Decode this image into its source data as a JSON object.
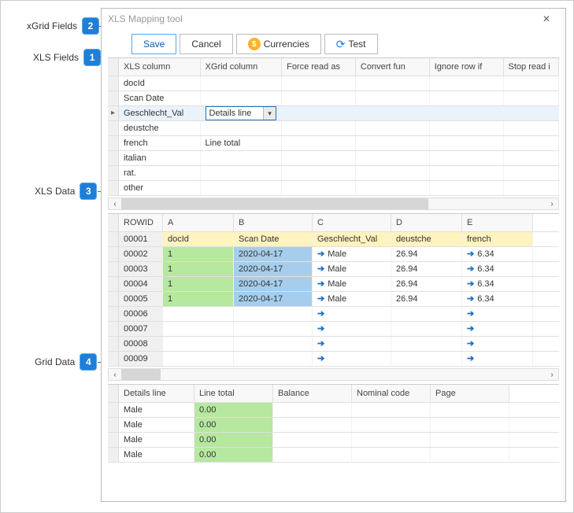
{
  "callouts": [
    {
      "num": "1",
      "label": "XLS Fields"
    },
    {
      "num": "2",
      "label": "xGrid Fields"
    },
    {
      "num": "3",
      "label": "XLS Data"
    },
    {
      "num": "4",
      "label": "Grid Data"
    }
  ],
  "window": {
    "title": "XLS Mapping tool",
    "close": "✕"
  },
  "toolbar": {
    "save": "Save",
    "cancel": "Cancel",
    "currencies": "Currencies",
    "test": "Test"
  },
  "mapGrid": {
    "headers": [
      "XLS column",
      "XGrid column",
      "Force read as",
      "Convert fun",
      "Ignore row if",
      "Stop read i"
    ],
    "rows": [
      {
        "xls": "docId",
        "xgrid": ""
      },
      {
        "xls": "Scan Date",
        "xgrid": ""
      },
      {
        "xls": "Geschlecht_Val",
        "xgrid": "Details line",
        "combo": true,
        "selected": true
      },
      {
        "xls": "deustche",
        "xgrid": ""
      },
      {
        "xls": "french",
        "xgrid": "Line total"
      },
      {
        "xls": "italian",
        "xgrid": ""
      },
      {
        "xls": "rat.",
        "xgrid": ""
      },
      {
        "xls": "other",
        "xgrid": ""
      }
    ]
  },
  "dataGrid": {
    "headers": [
      "ROWID",
      "A",
      "B",
      "C",
      "D",
      "E"
    ],
    "rows": [
      {
        "rowid": "00001",
        "A": "docId",
        "B": "Scan Date",
        "C": "Geschlecht_Val",
        "D": "deustche",
        "E": "french",
        "hdr": true
      },
      {
        "rowid": "00002",
        "A": "1",
        "B": "2020-04-17",
        "C": "Male",
        "D": "26.94",
        "E": "6.34",
        "arrowC": true,
        "arrowE": true,
        "greenA": true,
        "blueB": true
      },
      {
        "rowid": "00003",
        "A": "1",
        "B": "2020-04-17",
        "C": "Male",
        "D": "26.94",
        "E": "6.34",
        "arrowC": true,
        "arrowE": true,
        "greenA": true,
        "blueB": true
      },
      {
        "rowid": "00004",
        "A": "1",
        "B": "2020-04-17",
        "C": "Male",
        "D": "26.94",
        "E": "6.34",
        "arrowC": true,
        "arrowE": true,
        "greenA": true,
        "blueB": true
      },
      {
        "rowid": "00005",
        "A": "1",
        "B": "2020-04-17",
        "C": "Male",
        "D": "26.94",
        "E": "6.34",
        "arrowC": true,
        "arrowE": true,
        "greenA": true,
        "blueB": true
      },
      {
        "rowid": "00006",
        "A": "",
        "B": "",
        "C": "",
        "D": "",
        "E": "",
        "arrowC": true,
        "arrowE": true
      },
      {
        "rowid": "00007",
        "A": "",
        "B": "",
        "C": "",
        "D": "",
        "E": "",
        "arrowC": true,
        "arrowE": true
      },
      {
        "rowid": "00008",
        "A": "",
        "B": "",
        "C": "",
        "D": "",
        "E": "",
        "arrowC": true,
        "arrowE": true
      },
      {
        "rowid": "00009",
        "A": "",
        "B": "",
        "C": "",
        "D": "",
        "E": "",
        "arrowC": true,
        "arrowE": true
      }
    ]
  },
  "gridData": {
    "headers": [
      "Details line",
      "Line total",
      "Balance",
      "Nominal code",
      "Page"
    ],
    "rows": [
      {
        "details": "Male",
        "total": "0.00"
      },
      {
        "details": "Male",
        "total": "0.00"
      },
      {
        "details": "Male",
        "total": "0.00"
      },
      {
        "details": "Male",
        "total": "0.00"
      }
    ]
  },
  "scroll": {
    "left": "‹",
    "right": "›"
  }
}
